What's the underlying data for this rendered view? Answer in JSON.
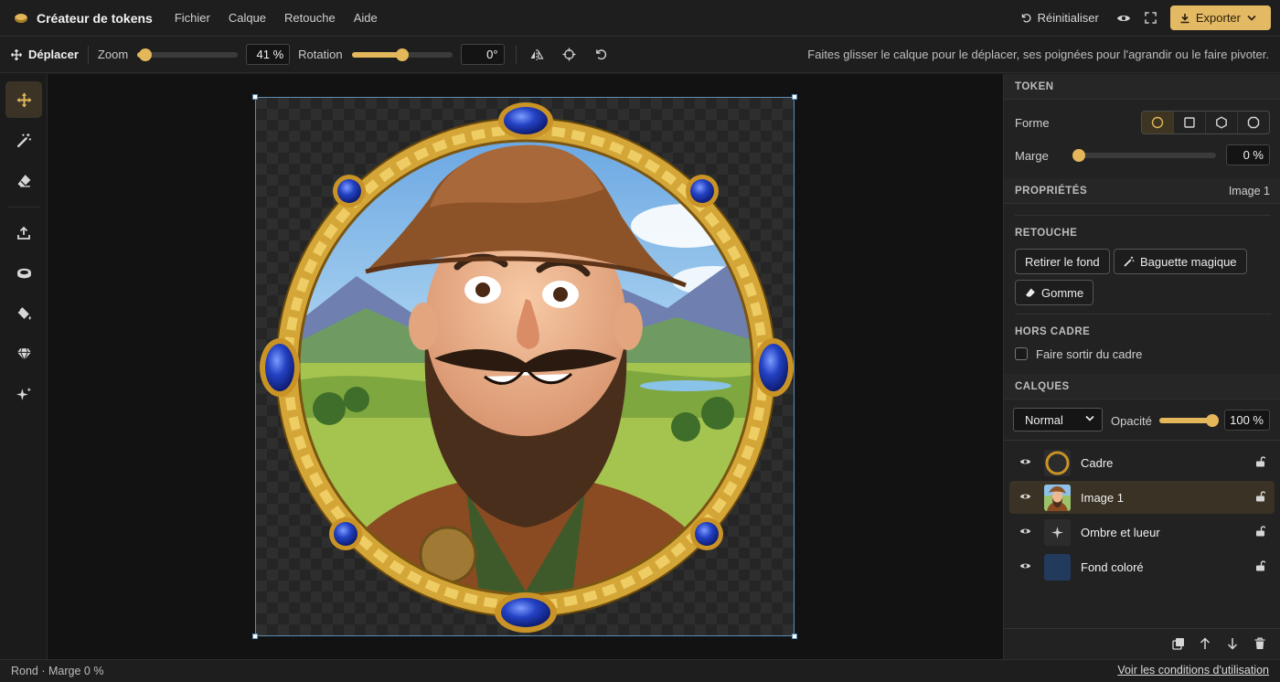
{
  "app": {
    "title": "Créateur de tokens",
    "menu": [
      "Fichier",
      "Calque",
      "Retouche",
      "Aide"
    ],
    "reset_label": "Réinitialiser",
    "export_label": "Exporter"
  },
  "toolbar": {
    "move_label": "Déplacer",
    "zoom_label": "Zoom",
    "zoom_value": "41 %",
    "zoom_level": 0.08,
    "rotation_label": "Rotation",
    "rotation_value": "0°",
    "rotation_level": 0.5,
    "hint": "Faites glisser le calque pour le déplacer, ses poignées pour l'agrandir ou le faire pivoter."
  },
  "left_tools": [
    "move-icon",
    "magic-wand-icon",
    "eraser-icon",
    "upload-icon",
    "frame-ring-icon",
    "fill-bucket-icon",
    "gem-icon",
    "sparkles-icon"
  ],
  "panel": {
    "token": {
      "title": "TOKEN",
      "shape_label": "Forme",
      "shapes": [
        "circle-icon",
        "square-icon",
        "hexagon-icon",
        "octagon-icon"
      ],
      "active_shape": 0,
      "margin_label": "Marge",
      "margin_value": "0 %",
      "margin_level": 0
    },
    "properties": {
      "title": "PROPRIÉTÉS",
      "selected": "Image 1"
    },
    "retouch": {
      "title": "RETOUCHE",
      "remove_bg": "Retirer le fond",
      "magic_wand": "Baguette magique",
      "eraser": "Gomme"
    },
    "outside": {
      "title": "HORS CADRE",
      "checkbox_label": "Faire sortir du cadre",
      "checked": false
    },
    "layers": {
      "title": "CALQUES",
      "blend_mode": "Normal",
      "opacity_label": "Opacité",
      "opacity_value": "100 %",
      "opacity_level": 1.0,
      "items": [
        {
          "name": "Cadre",
          "thumb": "frame",
          "active": false
        },
        {
          "name": "Image 1",
          "thumb": "portrait",
          "active": true
        },
        {
          "name": "Ombre et lueur",
          "thumb": "sparkle",
          "active": false
        },
        {
          "name": "Fond coloré",
          "thumb": "color",
          "active": false
        }
      ]
    }
  },
  "status": {
    "left": "Rond · Marge 0 %",
    "right_link": "Voir les conditions d'utilisation"
  },
  "colors": {
    "accent": "#e4b964",
    "frame_gold": "#d4a637",
    "gem_blue": "#1f3fb8",
    "fill_color": "#223a5c",
    "selection": "#5a8fb5"
  }
}
